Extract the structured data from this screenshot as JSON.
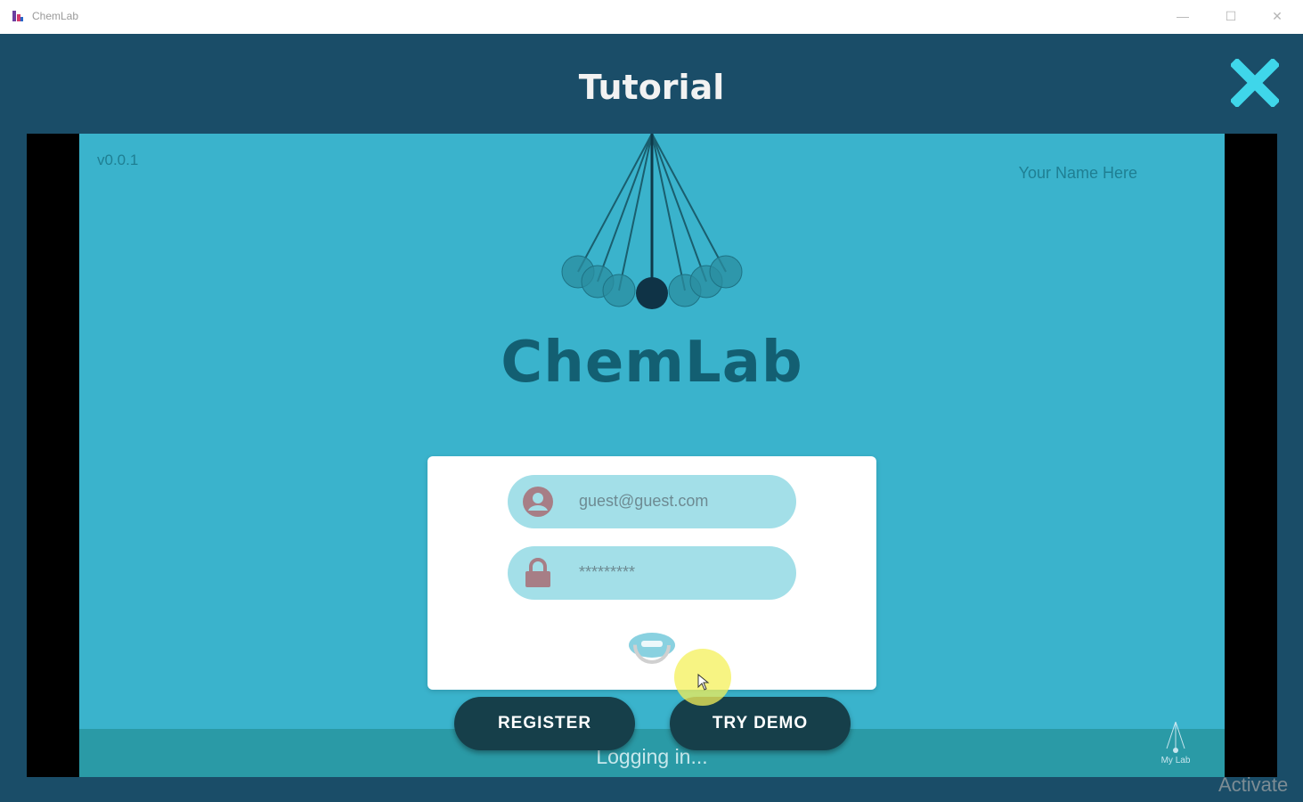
{
  "window": {
    "title": "ChemLab",
    "minimize_label": "—",
    "maximize_label": "☐",
    "close_label": "✕"
  },
  "dialog": {
    "title": "Tutorial"
  },
  "app": {
    "version": "v0.0.1",
    "user_name": "Your Name Here",
    "brand": "ChemLab",
    "login": {
      "email_value": "guest@guest.com",
      "password_value": "*********"
    },
    "buttons": {
      "register": "REGISTER",
      "try_demo": "TRY DEMO"
    },
    "status": "Logging in...",
    "corner_logo_text": "My Lab"
  },
  "watermark": "Activate",
  "colors": {
    "header_bg": "#1a4d68",
    "app_bg": "#3ab3cc",
    "brand_text": "#135f72",
    "field_bg": "#a3dfe8",
    "button_bg": "#163f4a",
    "close_x": "#3fd6ea"
  },
  "icons": {
    "dialog_close": "close-x-icon",
    "email_field": "user-icon",
    "password_field": "lock-icon",
    "logo": "newtons-cradle-icon",
    "loading": "spinner-icon"
  }
}
